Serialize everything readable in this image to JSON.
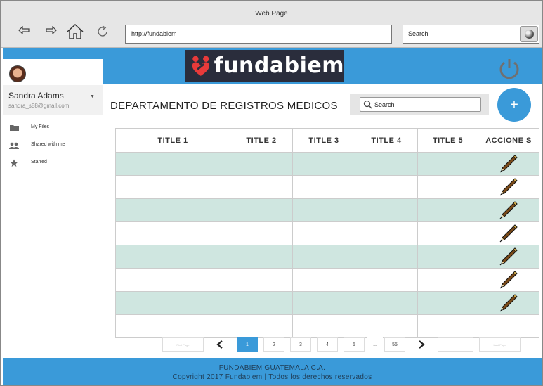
{
  "browser": {
    "window_title": "Web Page",
    "url": "http://fundabiem",
    "search_placeholder": "Search"
  },
  "brand": {
    "logo_text": "fundabiem",
    "banner_color": "#3a9ad9",
    "logo_bg": "#2a2d3c",
    "logo_icon_color": "#e83a3a"
  },
  "sidebar": {
    "user_name": "Sandra Adams",
    "user_email": "sandra_s88@gmail.com",
    "items": [
      {
        "label": "My Files",
        "icon": "folder-icon"
      },
      {
        "label": "Shared with me",
        "icon": "people-icon"
      },
      {
        "label": "Starred",
        "icon": "star-icon"
      }
    ]
  },
  "main": {
    "title": "DEPARTAMENTO DE REGISTROS MEDICOS",
    "search_placeholder": "Search",
    "add_button": "+"
  },
  "table": {
    "headers": [
      "TITLE 1",
      "TITLE 2",
      "TITLE 3",
      "TITLE 4",
      "TITLE 5",
      "ACCIONE S"
    ],
    "row_count": 8,
    "edit_icon": "pencil-icon",
    "alt_row_color": "#cfe6e0"
  },
  "pagination": {
    "first_label": "First Page",
    "last_label": "Last Page",
    "prev": "<",
    "next": ">",
    "pages": [
      "1",
      "2",
      "3",
      "4",
      "5"
    ],
    "ellipsis": "...",
    "last_page": "55",
    "current": "1"
  },
  "footer": {
    "line1": "FUNDABIEM GUATEMALA C.A.",
    "line2": "Copyright 2017 Fundabiem | Todos los derechos reservados"
  }
}
